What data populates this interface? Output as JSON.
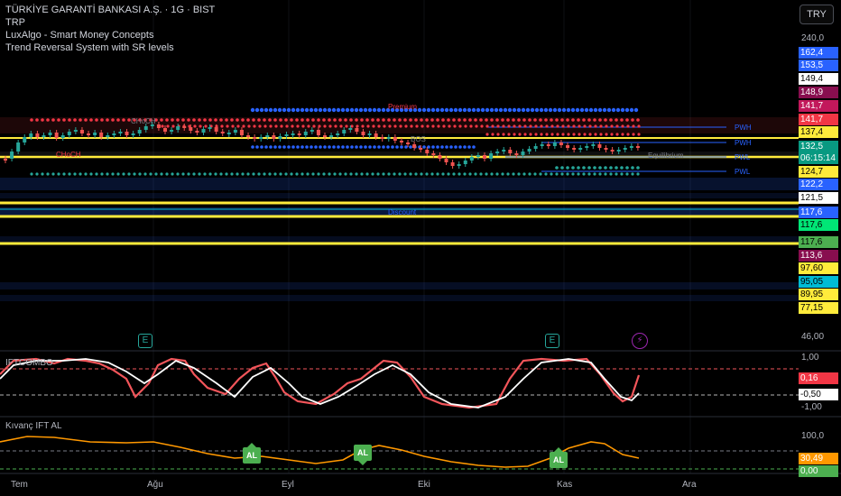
{
  "header": {
    "symbol_line": "TÜRKİYE GARANTİ BANKASI A.Ş. · 1G · BIST",
    "indicators": [
      "TRP",
      "LuxAlgo - Smart Money Concepts",
      "Trend Reversal System with SR levels"
    ],
    "currency_button": "TRY"
  },
  "price_scale": {
    "top_label": "240,0",
    "mid_label": "46,00"
  },
  "price_tags": [
    {
      "text": "162,4",
      "bg": "#2962ff",
      "fg": "#ffffff"
    },
    {
      "text": "153,5",
      "bg": "#2962ff",
      "fg": "#ffffff"
    },
    {
      "text": "149,4",
      "bg": "#ffffff",
      "fg": "#000000"
    },
    {
      "text": "148,9",
      "bg": "#880e4f",
      "fg": "#ffffff"
    },
    {
      "text": "141,7",
      "bg": "#c2185b",
      "fg": "#ffffff"
    },
    {
      "text": "141,7",
      "bg": "#f23645",
      "fg": "#ffffff"
    },
    {
      "text": "137,4",
      "bg": "#ffeb3b",
      "fg": "#000000"
    },
    {
      "text": "132,5",
      "bg": "#089981",
      "fg": "#ffffff"
    },
    {
      "text": "06:15:14",
      "bg": "#089981",
      "fg": "#ffffff"
    },
    {
      "text": "124,7",
      "bg": "#ffeb3b",
      "fg": "#000000"
    },
    {
      "text": "122,2",
      "bg": "#2962ff",
      "fg": "#ffffff"
    },
    {
      "text": "121,5",
      "bg": "#ffffff",
      "fg": "#000000"
    },
    {
      "text": "117,6",
      "bg": "#2962ff",
      "fg": "#ffffff"
    },
    {
      "text": "117,6",
      "bg": "#00e676",
      "fg": "#000000"
    },
    {
      "text": "117,6",
      "bg": "#4caf50",
      "fg": "#000000"
    },
    {
      "text": "113,6",
      "bg": "#880e4f",
      "fg": "#ffffff"
    },
    {
      "text": "97,60",
      "bg": "#ffeb3b",
      "fg": "#000000"
    },
    {
      "text": "95,05",
      "bg": "#00bcd4",
      "fg": "#000000"
    },
    {
      "text": "89,95",
      "bg": "#ffeb3b",
      "fg": "#000000"
    },
    {
      "text": "77,15",
      "bg": "#ffeb3b",
      "fg": "#000000"
    }
  ],
  "smc_labels": {
    "premium": "Premium",
    "equilibrium": "Equilibrium",
    "discount": "Discount",
    "pwh_1": "PWH",
    "pwh_2": "PWH",
    "pwl_1": "PWL",
    "pwl_2": "PWL",
    "chch_1": "CHoCH",
    "chch_2": "CHoCH",
    "bos": "BOS"
  },
  "panel_ift": {
    "title": "IFTCOMBO",
    "scale_top": "1,00",
    "scale_bottom": "-1,00",
    "tag_red": "0,16",
    "tag_white": "-0,50"
  },
  "panel_kivanc": {
    "title": "Kıvanç IFT AL",
    "scale_top": "100,0",
    "tag_orange": "30,49",
    "tag_green": "0,00",
    "signal_label": "AL"
  },
  "x_axis": [
    "Tem",
    "Ağu",
    "Eyl",
    "Eki",
    "Kas",
    "Ara"
  ],
  "icons": [
    "earnings-icon",
    "earnings-icon",
    "flash-icon"
  ],
  "colors": {
    "bull": "#26a69a",
    "bear": "#ef5350",
    "sr_yellow": "#ffeb3b",
    "ift_red": "#f2555a",
    "ift_white": "#ffffff",
    "kivanc_orange": "#ff9800"
  }
}
